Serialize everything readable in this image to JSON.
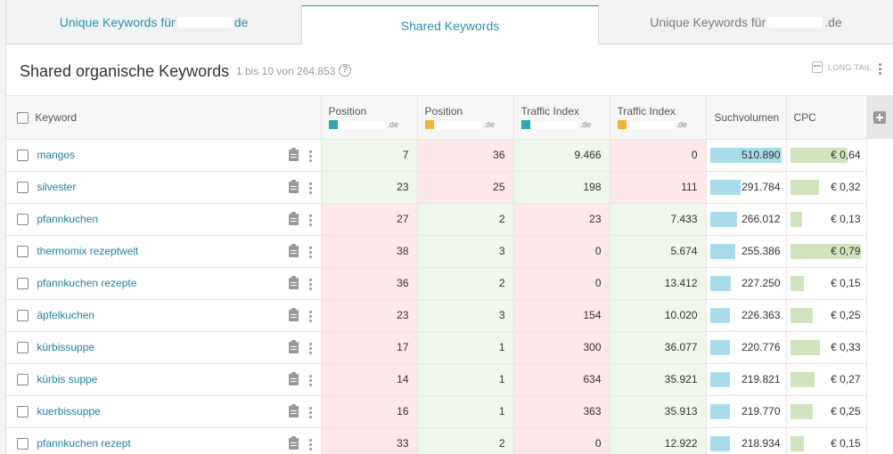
{
  "tabs": [
    {
      "prefix": "Unique Keywords für ",
      "suffix": "de"
    },
    {
      "label": "Shared Keywords"
    },
    {
      "prefix": "Unique Keywords für ",
      "suffix": ".de"
    }
  ],
  "header": {
    "title": "Shared organische Keywords",
    "count": "1 bis 10 von 264.853",
    "help": "?",
    "longtail": "LONG TAIL"
  },
  "columns": {
    "keyword": "Keyword",
    "position1": "Position",
    "position1_domain": ".de",
    "position2": "Position",
    "position2_domain": ".de",
    "traffic1": "Traffic Index",
    "traffic1_domain": ".de",
    "traffic2": "Traffic Index",
    "traffic2_domain": ".de",
    "volume": "Suchvolumen",
    "cpc": "CPC"
  },
  "colors": {
    "domain1": "#2ba7b9",
    "domain2": "#f3b43e",
    "win": "#eef7e9",
    "loss": "#fde8ea",
    "volume_bar": "#a9dce8",
    "cpc_bar": "#cfe3bd"
  },
  "rows": [
    {
      "keyword": "mangos",
      "pos1": "7",
      "pos2": "36",
      "ti1": "9.466",
      "ti2": "0",
      "volume": "510.890",
      "volume_frac": 1.0,
      "cpc": "€ 0,64",
      "cpc_frac": 0.81
    },
    {
      "keyword": "silvester",
      "pos1": "23",
      "pos2": "25",
      "ti1": "198",
      "ti2": "111",
      "volume": "291.784",
      "volume_frac": 0.43,
      "cpc": "€ 0,32",
      "cpc_frac": 0.4
    },
    {
      "keyword": "pfannkuchen",
      "pos1": "27",
      "pos2": "2",
      "ti1": "23",
      "ti2": "7.433",
      "volume": "266.012",
      "volume_frac": 0.37,
      "cpc": "€ 0,13",
      "cpc_frac": 0.16
    },
    {
      "keyword": "thermomix rezeptwelt",
      "pos1": "38",
      "pos2": "3",
      "ti1": "0",
      "ti2": "5.674",
      "volume": "255.386",
      "volume_frac": 0.35,
      "cpc": "€ 0,79",
      "cpc_frac": 1.0
    },
    {
      "keyword": "pfannkuchen rezepte",
      "pos1": "36",
      "pos2": "2",
      "ti1": "0",
      "ti2": "13.412",
      "volume": "227.250",
      "volume_frac": 0.29,
      "cpc": "€ 0,15",
      "cpc_frac": 0.19
    },
    {
      "keyword": "äpfelkuchen",
      "pos1": "23",
      "pos2": "3",
      "ti1": "154",
      "ti2": "10.020",
      "volume": "226.363",
      "volume_frac": 0.28,
      "cpc": "€ 0,25",
      "cpc_frac": 0.32
    },
    {
      "keyword": "kürbissuppe",
      "pos1": "17",
      "pos2": "1",
      "ti1": "300",
      "ti2": "36.077",
      "volume": "220.776",
      "volume_frac": 0.27,
      "cpc": "€ 0,33",
      "cpc_frac": 0.42
    },
    {
      "keyword": "kürbis suppe",
      "pos1": "14",
      "pos2": "1",
      "ti1": "634",
      "ti2": "35.921",
      "volume": "219.821",
      "volume_frac": 0.27,
      "cpc": "€ 0,27",
      "cpc_frac": 0.34
    },
    {
      "keyword": "kuerbissuppe",
      "pos1": "16",
      "pos2": "1",
      "ti1": "363",
      "ti2": "35.913",
      "volume": "219.770",
      "volume_frac": 0.27,
      "cpc": "€ 0,25",
      "cpc_frac": 0.32
    },
    {
      "keyword": "pfannkuchen rezept",
      "pos1": "33",
      "pos2": "2",
      "ti1": "0",
      "ti2": "12.922",
      "volume": "218.934",
      "volume_frac": 0.27,
      "cpc": "€ 0,15",
      "cpc_frac": 0.19
    }
  ]
}
